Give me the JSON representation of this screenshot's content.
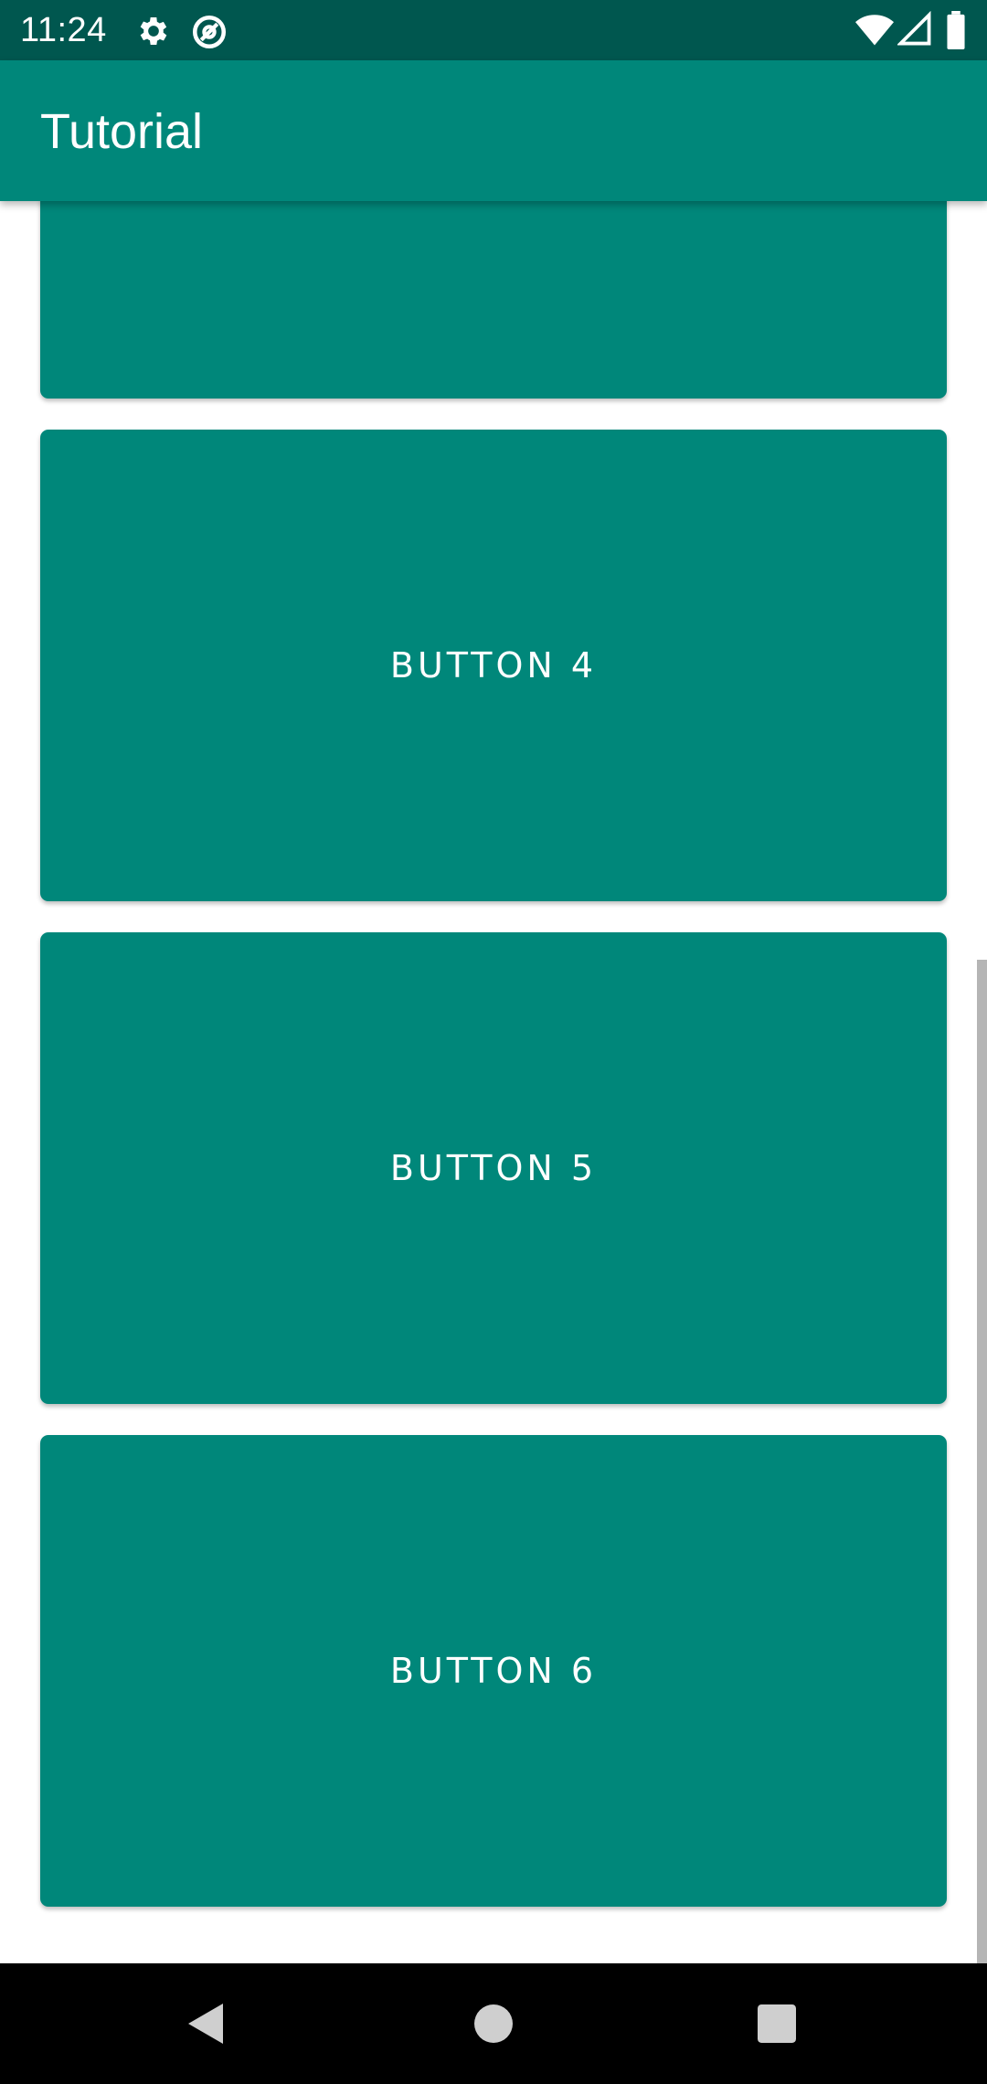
{
  "status_bar": {
    "time": "11:24",
    "icons": [
      "gear-icon",
      "no-sync-icon",
      "wifi-icon",
      "signal-icon",
      "battery-icon"
    ]
  },
  "app_bar": {
    "title": "Tutorial"
  },
  "buttons": [
    {
      "label": ""
    },
    {
      "label": "BUTTON 4"
    },
    {
      "label": "BUTTON 5"
    },
    {
      "label": "BUTTON 6"
    }
  ],
  "nav_bar": {
    "icons": [
      "back-triangle-icon",
      "home-circle-icon",
      "recents-square-icon"
    ]
  },
  "colors": {
    "status_bar": "#00574f",
    "primary": "#00877a",
    "text_on_primary": "#ffffff",
    "background": "#ffffff",
    "nav_bar": "#000000"
  }
}
